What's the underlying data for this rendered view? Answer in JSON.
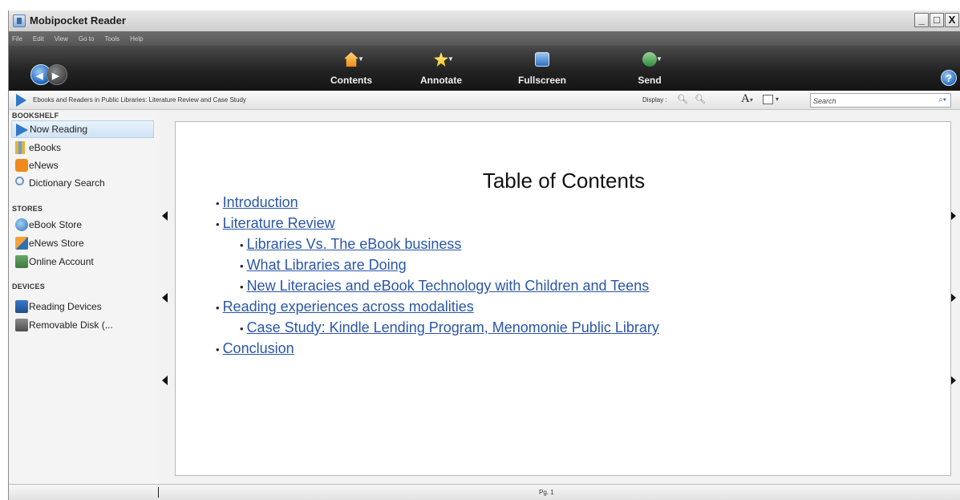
{
  "window": {
    "title": "Mobipocket Reader",
    "controls": [
      "_",
      "□",
      "X"
    ]
  },
  "menu": [
    "File",
    "Edit",
    "View",
    "Go to",
    "Tools",
    "Help"
  ],
  "toolbar": {
    "tools": [
      {
        "label": "Contents",
        "icon": "home-icon"
      },
      {
        "label": "Annotate",
        "icon": "star-icon"
      },
      {
        "label": "Fullscreen",
        "icon": "fullscreen-icon"
      },
      {
        "label": "Send",
        "icon": "send-icon"
      }
    ],
    "help": "?"
  },
  "infobar": {
    "breadcrumb": "Ebooks and Readers in Public Libraries: Literature Review and Case Study",
    "display_label": "Display :",
    "search_placeholder": "Search"
  },
  "sidebar": {
    "sections": [
      {
        "heading": "BOOKSHELF",
        "items": [
          "Now Reading",
          "eBooks",
          "eNews",
          "Dictionary Search"
        ]
      },
      {
        "heading": "STORES",
        "items": [
          "eBook Store",
          "eNews Store",
          "Online Account"
        ]
      },
      {
        "heading": "DEVICES",
        "items": [
          "Reading Devices",
          "Removable Disk (..."
        ]
      }
    ],
    "selected": "Now Reading"
  },
  "page": {
    "title": "Table of Contents",
    "toc": [
      {
        "level": 1,
        "text": "Introduction"
      },
      {
        "level": 1,
        "text": "Literature Review"
      },
      {
        "level": 2,
        "text": "Libraries Vs. The eBook business"
      },
      {
        "level": 2,
        "text": "What Libraries are Doing"
      },
      {
        "level": 2,
        "text": "New Literacies and eBook Technology with Children and Teens"
      },
      {
        "level": 1,
        "text": "Reading experiences across modalities"
      },
      {
        "level": 2,
        "text": "Case Study: Kindle Lending Program, Menomonie Public Library"
      },
      {
        "level": 1,
        "text": "Conclusion"
      }
    ]
  },
  "status": {
    "page_indicator": "Pg. 1"
  }
}
